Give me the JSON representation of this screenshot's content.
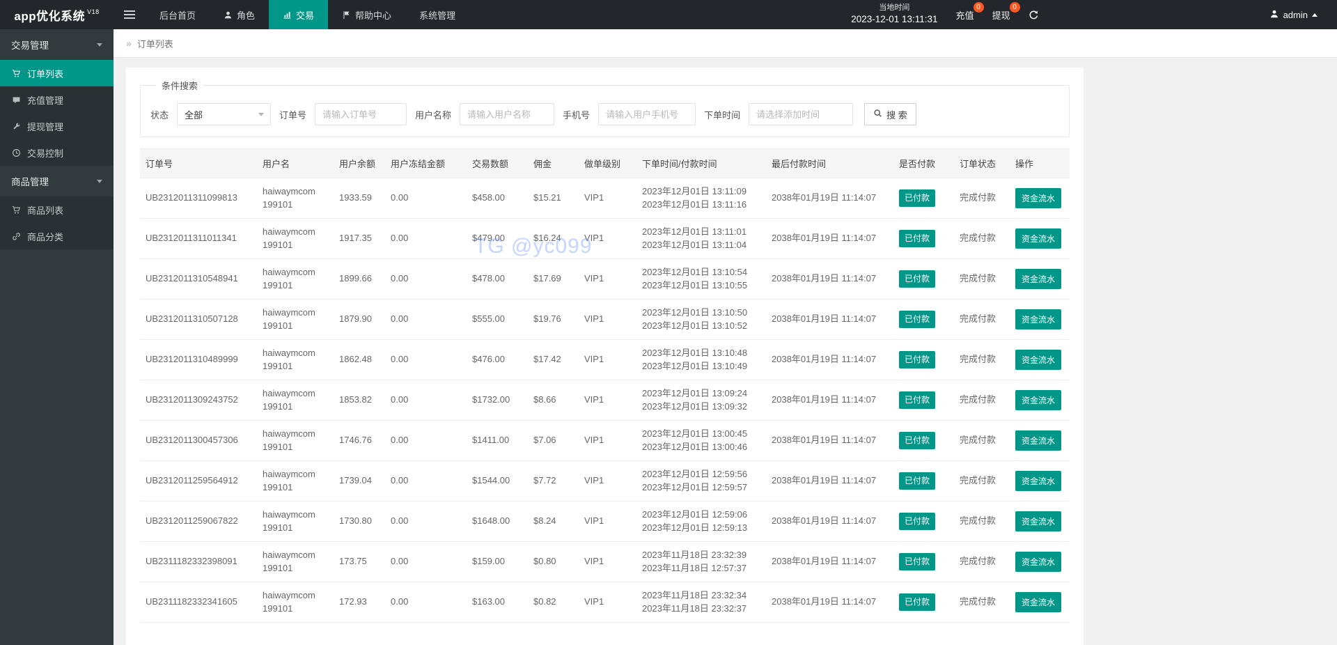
{
  "colors": {
    "accent_teal": "#009688",
    "badge_red": "#ff5722",
    "navbar_bg": "#23272b",
    "sidebar_bg": "#313a3d"
  },
  "navbar": {
    "logo": "app优化系统",
    "version": "V18",
    "items": [
      {
        "key": "home",
        "label": "后台首页"
      },
      {
        "key": "roles",
        "label": "角色",
        "icon": "user"
      },
      {
        "key": "trade",
        "label": "交易",
        "icon": "chart",
        "active": true
      },
      {
        "key": "help",
        "label": "帮助中心",
        "icon": "flag"
      },
      {
        "key": "system",
        "label": "系统管理"
      }
    ],
    "time_label": "当地时间",
    "time_value": "2023-12-01 13:11:31",
    "recharge_label": "充值",
    "recharge_badge": "0",
    "withdraw_label": "提现",
    "withdraw_badge": "0",
    "admin_label": "admin"
  },
  "sidebar": {
    "items": [
      {
        "key": "trade-manage",
        "label": "交易管理",
        "type": "group"
      },
      {
        "key": "order-list",
        "label": "订单列表",
        "icon": "cart",
        "active": true
      },
      {
        "key": "recharge-manage",
        "label": "充值管理",
        "icon": "comment"
      },
      {
        "key": "withdraw-manage",
        "label": "提现管理",
        "icon": "wrench"
      },
      {
        "key": "trade-control",
        "label": "交易控制",
        "icon": "clock"
      },
      {
        "key": "goods-manage",
        "label": "商品管理",
        "type": "group"
      },
      {
        "key": "goods-list",
        "label": "商品列表",
        "icon": "cart"
      },
      {
        "key": "goods-category",
        "label": "商品分类",
        "icon": "link"
      }
    ]
  },
  "breadcrumb": {
    "icon": "»",
    "label": "订单列表"
  },
  "search": {
    "legend": "条件搜索",
    "status_label": "状态",
    "status_value": "全部",
    "order_label": "订单号",
    "order_placeholder": "请输入订单号",
    "user_label": "用户名称",
    "user_placeholder": "请输入用户名称",
    "phone_label": "手机号",
    "phone_placeholder": "请输入用户手机号",
    "time_label": "下单时间",
    "time_placeholder": "请选择添加时间",
    "search_button": "搜 索"
  },
  "watermark": "TG @yc099",
  "table": {
    "columns": [
      "订单号",
      "用户名",
      "用户余额",
      "用户冻结金额",
      "交易数额",
      "佣金",
      "做单级别",
      "下单时间/付款时间",
      "最后付款时间",
      "是否付款",
      "订单状态",
      "操作"
    ],
    "rows": [
      {
        "order_no": "UB2312011311099813",
        "user1": "haiwaymcom",
        "user2": "199101",
        "balance": "1933.59",
        "frozen": "0.00",
        "amount": "$458.00",
        "commission": "$15.21",
        "level": "VIP1",
        "time_order": "2023年12月01日 13:11:09",
        "time_pay": "2023年12月01日 13:11:16",
        "last_pay": "2038年01月19日 11:14:07",
        "paid": "已付款",
        "status": "完成付款",
        "action": "资金流水"
      },
      {
        "order_no": "UB2312011311011341",
        "user1": "haiwaymcom",
        "user2": "199101",
        "balance": "1917.35",
        "frozen": "0.00",
        "amount": "$479.00",
        "commission": "$16.24",
        "level": "VIP1",
        "time_order": "2023年12月01日 13:11:01",
        "time_pay": "2023年12月01日 13:11:04",
        "last_pay": "2038年01月19日 11:14:07",
        "paid": "已付款",
        "status": "完成付款",
        "action": "资金流水"
      },
      {
        "order_no": "UB2312011310548941",
        "user1": "haiwaymcom",
        "user2": "199101",
        "balance": "1899.66",
        "frozen": "0.00",
        "amount": "$478.00",
        "commission": "$17.69",
        "level": "VIP1",
        "time_order": "2023年12月01日 13:10:54",
        "time_pay": "2023年12月01日 13:10:55",
        "last_pay": "2038年01月19日 11:14:07",
        "paid": "已付款",
        "status": "完成付款",
        "action": "资金流水"
      },
      {
        "order_no": "UB2312011310507128",
        "user1": "haiwaymcom",
        "user2": "199101",
        "balance": "1879.90",
        "frozen": "0.00",
        "amount": "$555.00",
        "commission": "$19.76",
        "level": "VIP1",
        "time_order": "2023年12月01日 13:10:50",
        "time_pay": "2023年12月01日 13:10:52",
        "last_pay": "2038年01月19日 11:14:07",
        "paid": "已付款",
        "status": "完成付款",
        "action": "资金流水"
      },
      {
        "order_no": "UB2312011310489999",
        "user1": "haiwaymcom",
        "user2": "199101",
        "balance": "1862.48",
        "frozen": "0.00",
        "amount": "$476.00",
        "commission": "$17.42",
        "level": "VIP1",
        "time_order": "2023年12月01日 13:10:48",
        "time_pay": "2023年12月01日 13:10:49",
        "last_pay": "2038年01月19日 11:14:07",
        "paid": "已付款",
        "status": "完成付款",
        "action": "资金流水"
      },
      {
        "order_no": "UB2312011309243752",
        "user1": "haiwaymcom",
        "user2": "199101",
        "balance": "1853.82",
        "frozen": "0.00",
        "amount": "$1732.00",
        "commission": "$8.66",
        "level": "VIP1",
        "time_order": "2023年12月01日 13:09:24",
        "time_pay": "2023年12月01日 13:09:32",
        "last_pay": "2038年01月19日 11:14:07",
        "paid": "已付款",
        "status": "完成付款",
        "action": "资金流水"
      },
      {
        "order_no": "UB2312011300457306",
        "user1": "haiwaymcom",
        "user2": "199101",
        "balance": "1746.76",
        "frozen": "0.00",
        "amount": "$1411.00",
        "commission": "$7.06",
        "level": "VIP1",
        "time_order": "2023年12月01日 13:00:45",
        "time_pay": "2023年12月01日 13:00:46",
        "last_pay": "2038年01月19日 11:14:07",
        "paid": "已付款",
        "status": "完成付款",
        "action": "资金流水"
      },
      {
        "order_no": "UB2312011259564912",
        "user1": "haiwaymcom",
        "user2": "199101",
        "balance": "1739.04",
        "frozen": "0.00",
        "amount": "$1544.00",
        "commission": "$7.72",
        "level": "VIP1",
        "time_order": "2023年12月01日 12:59:56",
        "time_pay": "2023年12月01日 12:59:57",
        "last_pay": "2038年01月19日 11:14:07",
        "paid": "已付款",
        "status": "完成付款",
        "action": "资金流水"
      },
      {
        "order_no": "UB2312011259067822",
        "user1": "haiwaymcom",
        "user2": "199101",
        "balance": "1730.80",
        "frozen": "0.00",
        "amount": "$1648.00",
        "commission": "$8.24",
        "level": "VIP1",
        "time_order": "2023年12月01日 12:59:06",
        "time_pay": "2023年12月01日 12:59:13",
        "last_pay": "2038年01月19日 11:14:07",
        "paid": "已付款",
        "status": "完成付款",
        "action": "资金流水"
      },
      {
        "order_no": "UB2311182332398091",
        "user1": "haiwaymcom",
        "user2": "199101",
        "balance": "173.75",
        "frozen": "0.00",
        "amount": "$159.00",
        "commission": "$0.80",
        "level": "VIP1",
        "time_order": "2023年11月18日 23:32:39",
        "time_pay": "2023年11月18日 12:57:37",
        "last_pay": "2038年01月19日 11:14:07",
        "paid": "已付款",
        "status": "完成付款",
        "action": "资金流水"
      },
      {
        "order_no": "UB2311182332341605",
        "user1": "haiwaymcom",
        "user2": "199101",
        "balance": "172.93",
        "frozen": "0.00",
        "amount": "$163.00",
        "commission": "$0.82",
        "level": "VIP1",
        "time_order": "2023年11月18日 23:32:34",
        "time_pay": "2023年11月18日 23:32:37",
        "last_pay": "2038年01月19日 11:14:07",
        "paid": "已付款",
        "status": "完成付款",
        "action": "资金流水"
      }
    ]
  }
}
